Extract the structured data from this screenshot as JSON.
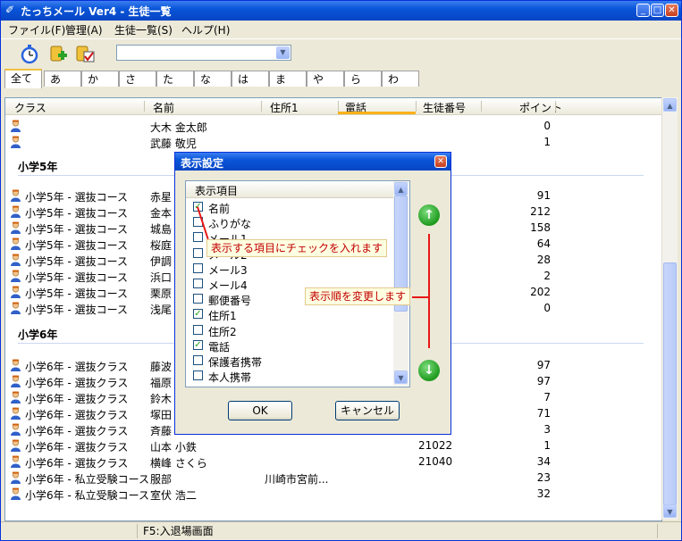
{
  "window": {
    "title": "たっちメール Ver4 - 生徒一覧"
  },
  "menu": [
    "ファイル(F)",
    "管理(A)",
    "生徒一覧(S)",
    "ヘルプ(H)"
  ],
  "toolbar": {
    "combo_value": ""
  },
  "tabs": [
    "全て",
    "あ",
    "か",
    "さ",
    "た",
    "な",
    "は",
    "ま",
    "や",
    "ら",
    "わ"
  ],
  "columns": [
    "クラス",
    "名前",
    "住所1",
    "電話",
    "生徒番号",
    "ポイント"
  ],
  "rows_top": [
    {
      "cls": "",
      "name": "大木 金太郎",
      "addr": "",
      "num": "",
      "pt": "0"
    },
    {
      "cls": "",
      "name": "武藤 敬児",
      "addr": "",
      "num": "",
      "pt": "1"
    }
  ],
  "group5": "小学5年",
  "rows5": [
    {
      "cls": "小学5年 - 選抜コース",
      "name": "赤星",
      "addr": "",
      "num": "",
      "pt": "91"
    },
    {
      "cls": "小学5年 - 選抜コース",
      "name": "金本",
      "addr": "",
      "num": "",
      "pt": "212"
    },
    {
      "cls": "小学5年 - 選抜コース",
      "name": "城島",
      "addr": "",
      "num": "",
      "pt": "158"
    },
    {
      "cls": "小学5年 - 選抜コース",
      "name": "桜庭",
      "addr": "",
      "num": "",
      "pt": "64"
    },
    {
      "cls": "小学5年 - 選抜コース",
      "name": "伊調",
      "addr": "",
      "num": "",
      "pt": "28"
    },
    {
      "cls": "小学5年 - 選抜コース",
      "name": "浜口",
      "addr": "",
      "num": "",
      "pt": "2"
    },
    {
      "cls": "小学5年 - 選抜コース",
      "name": "栗原",
      "addr": "",
      "num": "",
      "pt": "202"
    },
    {
      "cls": "小学5年 - 選抜コース",
      "name": "浅尾",
      "addr": "",
      "num": "",
      "pt": "0"
    }
  ],
  "group6": "小学6年",
  "rows6": [
    {
      "cls": "小学6年 - 選抜クラス",
      "name": "藤波",
      "addr": "",
      "num": "",
      "pt": "97"
    },
    {
      "cls": "小学6年 - 選抜クラス",
      "name": "福原",
      "addr": "",
      "num": "",
      "pt": "97"
    },
    {
      "cls": "小学6年 - 選抜クラス",
      "name": "鈴木",
      "addr": "",
      "num": "",
      "pt": "7"
    },
    {
      "cls": "小学6年 - 選抜クラス",
      "name": "塚田",
      "addr": "",
      "num": "",
      "pt": "71"
    },
    {
      "cls": "小学6年 - 選抜クラス",
      "name": "斉藤",
      "addr": "",
      "num": "",
      "pt": "3"
    },
    {
      "cls": "小学6年 - 選抜クラス",
      "name": "山本 小鉄",
      "addr": "",
      "num": "21022",
      "pt": "1"
    },
    {
      "cls": "小学6年 - 選抜クラス",
      "name": "横峰 さくら",
      "addr": "",
      "num": "21040",
      "pt": "34"
    },
    {
      "cls": "小学6年 - 私立受験コース",
      "name": "服部",
      "addr": "川崎市宮前...",
      "num": "",
      "pt": "23"
    },
    {
      "cls": "小学6年 - 私立受験コース",
      "name": "室伏 浩二",
      "addr": "",
      "num": "",
      "pt": "32"
    }
  ],
  "status": {
    "hint": "F5:入退場画面"
  },
  "dialog": {
    "title": "表示設定",
    "list_header": "表示項目",
    "items": [
      {
        "label": "名前",
        "checked": true
      },
      {
        "label": "ふりがな",
        "checked": false
      },
      {
        "label": "メール1",
        "checked": false
      },
      {
        "label": "メール2",
        "checked": false
      },
      {
        "label": "メール3",
        "checked": false
      },
      {
        "label": "メール4",
        "checked": false
      },
      {
        "label": "郵便番号",
        "checked": false
      },
      {
        "label": "住所1",
        "checked": true
      },
      {
        "label": "住所2",
        "checked": false
      },
      {
        "label": "電話",
        "checked": true
      },
      {
        "label": "保護者携帯",
        "checked": false
      },
      {
        "label": "本人携帯",
        "checked": false
      }
    ],
    "ok_label": "OK",
    "cancel_label": "キャンセル",
    "tip_check": "表示する項目にチェックを入れます",
    "tip_order": "表示順を変更します"
  }
}
